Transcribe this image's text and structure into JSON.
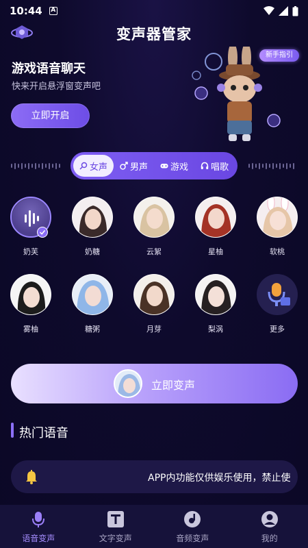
{
  "status_bar": {
    "time": "10:44",
    "a_icon": "A"
  },
  "header": {
    "title": "变声器管家"
  },
  "hero": {
    "title": "游戏语音聊天",
    "subtitle": "快来开启悬浮窗变声吧",
    "button_label": "立即开启",
    "guide_badge": "新手指引"
  },
  "tabs": [
    {
      "label": "女声",
      "icon": "magnify-female-icon",
      "active": true
    },
    {
      "label": "男声",
      "icon": "male-icon",
      "active": false
    },
    {
      "label": "游戏",
      "icon": "gamepad-icon",
      "active": false
    },
    {
      "label": "唱歌",
      "icon": "headphones-icon",
      "active": false
    }
  ],
  "voices": [
    {
      "name": "奶芙",
      "selected": true
    },
    {
      "name": "奶糖"
    },
    {
      "name": "云絮"
    },
    {
      "name": "星柚"
    },
    {
      "name": "软桃"
    },
    {
      "name": "雾柚"
    },
    {
      "name": "糖粥"
    },
    {
      "name": "月芽"
    },
    {
      "name": "梨涡"
    },
    {
      "name": "更多"
    }
  ],
  "main_button": {
    "label": "立即变声"
  },
  "hot": {
    "title": "热门语音"
  },
  "notice": {
    "text": "APP内功能仅供娱乐使用，禁止使"
  },
  "bottom_nav": [
    {
      "label": "语音变声",
      "icon": "microphone-icon",
      "active": true
    },
    {
      "label": "文字变声",
      "icon": "text-t-icon",
      "active": false
    },
    {
      "label": "音频变声",
      "icon": "audio-disc-icon",
      "active": false
    },
    {
      "label": "我的",
      "icon": "profile-icon",
      "active": false
    }
  ],
  "colors": {
    "accent": "#7e5ef3",
    "background": "#0e0a2c",
    "nav_background": "#16123a"
  }
}
